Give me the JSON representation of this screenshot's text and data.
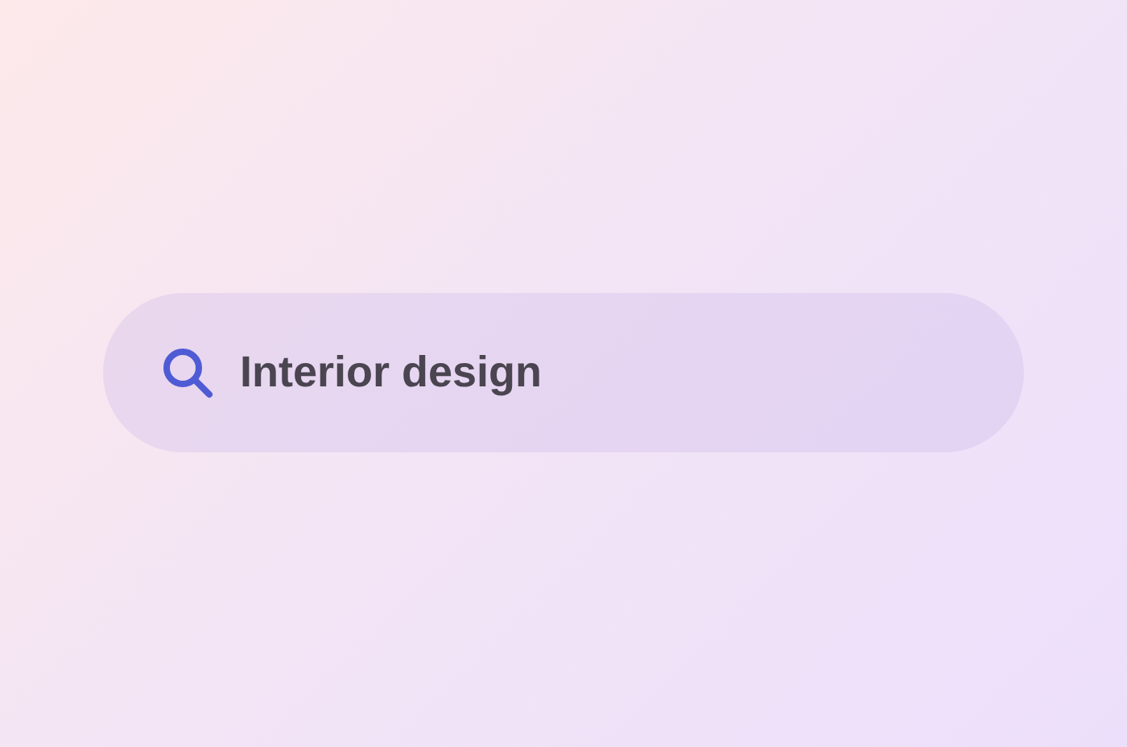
{
  "search": {
    "value": "Interior design"
  }
}
